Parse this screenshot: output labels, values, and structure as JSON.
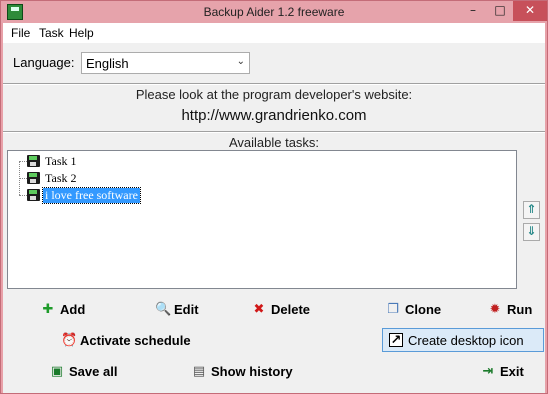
{
  "window": {
    "title": "Backup Aider 1.2 freeware",
    "minimize_glyph": "–",
    "maximize_glyph": "□",
    "close_glyph": "✕"
  },
  "menu": {
    "file": "File",
    "task": "Task",
    "help": "Help"
  },
  "language": {
    "label": "Language:",
    "selected": "English",
    "arrow_glyph": "⌄"
  },
  "developer": {
    "message": "Please look at the program developer's website:",
    "url": "http://www.grandrienko.com"
  },
  "tasks": {
    "header": "Available tasks:",
    "items": [
      {
        "label": "Task 1",
        "selected": false
      },
      {
        "label": "Task 2",
        "selected": false
      },
      {
        "label": "i love free software",
        "selected": true
      }
    ],
    "move_up_glyph": "⇑",
    "move_down_glyph": "⇓"
  },
  "buttons": {
    "add": {
      "label": "Add",
      "icon": "plus-icon",
      "glyph": "✚"
    },
    "edit": {
      "label": "Edit",
      "icon": "edit-icon",
      "glyph": "🔍"
    },
    "delete": {
      "label": "Delete",
      "icon": "delete-icon",
      "glyph": "✖"
    },
    "clone": {
      "label": "Clone",
      "icon": "clone-icon",
      "glyph": "❐"
    },
    "run": {
      "label": "Run",
      "icon": "run-icon",
      "glyph": "✹"
    },
    "activate_schedule": {
      "label": "Activate schedule",
      "icon": "alarm-clock-icon",
      "glyph": "⏰"
    },
    "create_desktop_icon": {
      "label": "Create desktop icon",
      "icon": "shortcut-icon",
      "glyph": "↗"
    },
    "save_all": {
      "label": "Save all",
      "icon": "save-icon",
      "glyph": "▣"
    },
    "show_history": {
      "label": "Show history",
      "icon": "history-icon",
      "glyph": "▤"
    },
    "exit": {
      "label": "Exit",
      "icon": "exit-icon",
      "glyph": "⇥"
    }
  },
  "colors": {
    "titlebar": "#e6a3ab",
    "close_button": "#c7505a",
    "selection": "#3399ff",
    "focused_button": "#dbeaf8"
  }
}
